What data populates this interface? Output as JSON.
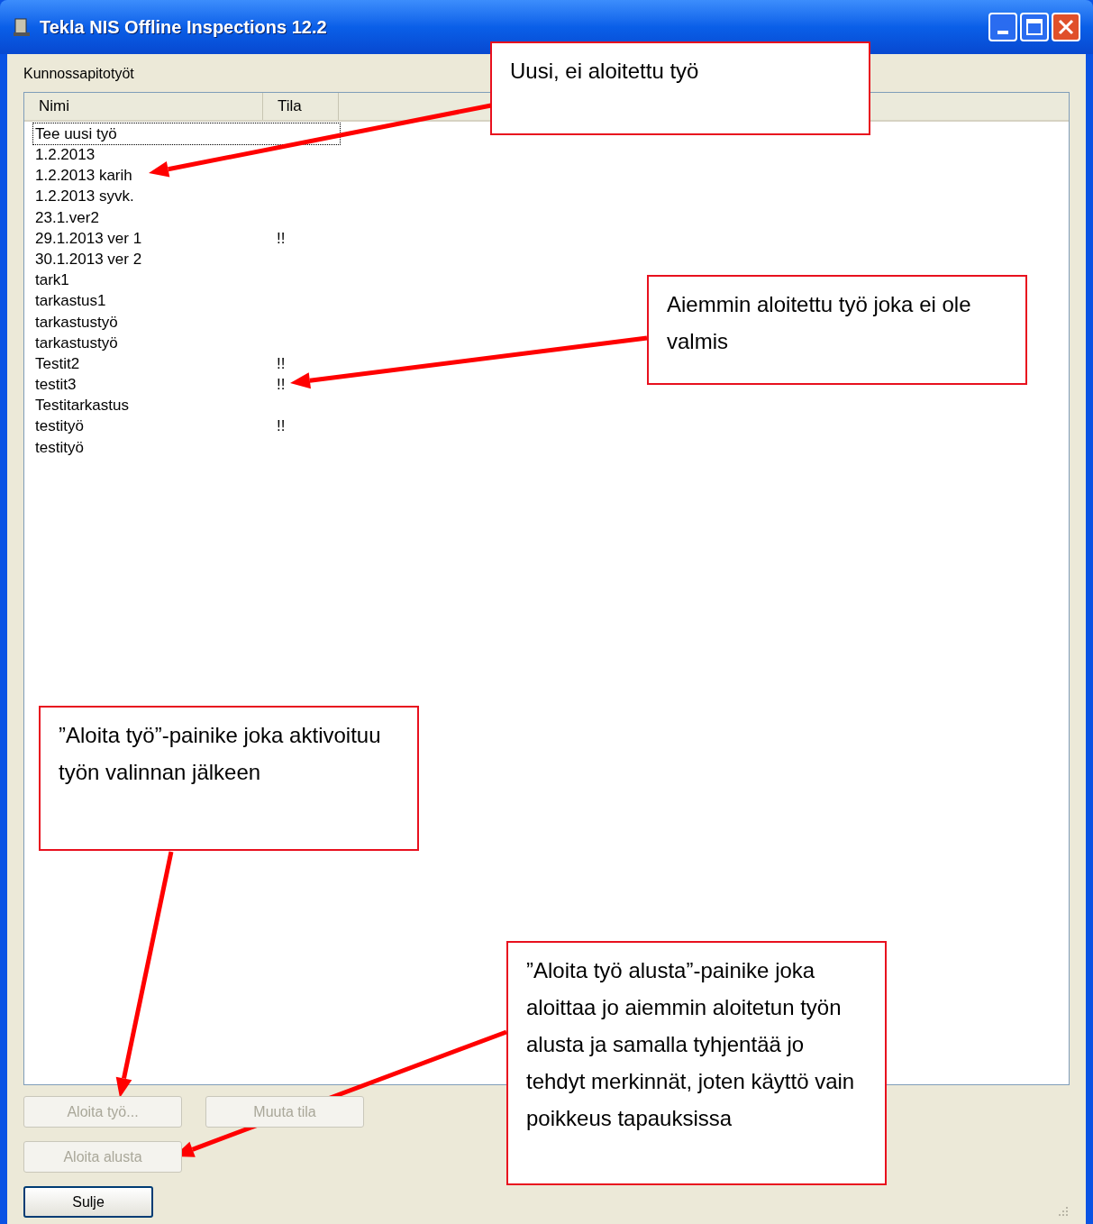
{
  "window": {
    "title": "Tekla NIS Offline Inspections 12.2"
  },
  "group_label": "Kunnossapitotyöt",
  "table": {
    "columns": [
      "Nimi",
      "Tila"
    ],
    "rows": [
      {
        "name": "Tee uusi työ",
        "status": "",
        "focused": true
      },
      {
        "name": "1.2.2013",
        "status": "",
        "focused": false
      },
      {
        "name": "1.2.2013 karih",
        "status": "",
        "focused": false
      },
      {
        "name": "1.2.2013 syvk.",
        "status": "",
        "focused": false
      },
      {
        "name": "23.1.ver2",
        "status": "",
        "focused": false
      },
      {
        "name": "29.1.2013 ver 1",
        "status": "!!",
        "focused": false
      },
      {
        "name": "30.1.2013 ver 2",
        "status": "",
        "focused": false
      },
      {
        "name": "tark1",
        "status": "",
        "focused": false
      },
      {
        "name": "tarkastus1",
        "status": "",
        "focused": false
      },
      {
        "name": "tarkastustyö",
        "status": "",
        "focused": false
      },
      {
        "name": "tarkastustyö",
        "status": "",
        "focused": false
      },
      {
        "name": "Testit2",
        "status": "!!",
        "focused": false
      },
      {
        "name": "testit3",
        "status": "!!",
        "focused": false
      },
      {
        "name": "Testitarkastus",
        "status": "",
        "focused": false
      },
      {
        "name": "testityö",
        "status": "!!",
        "focused": false
      },
      {
        "name": "testityö",
        "status": "",
        "focused": false
      }
    ]
  },
  "buttons": [
    {
      "label": "Aloita työ...",
      "disabled": true,
      "default": false
    },
    {
      "label": "Muuta tila",
      "disabled": true,
      "default": false
    },
    {
      "label": "Aloita alusta",
      "disabled": true,
      "default": false
    },
    {
      "label": "Sulje",
      "disabled": false,
      "default": true
    }
  ],
  "callouts": [
    {
      "text": "Uusi, ei aloitettu työ"
    },
    {
      "text": "Aiemmin aloitettu työ joka ei ole valmis"
    },
    {
      "text": "”Aloita työ”-painike joka aktivoituu työn valinnan jälkeen"
    },
    {
      "text": "”Aloita työ alusta”-painike joka aloittaa jo aiemmin aloitetun työn alusta ja samalla tyhjentää jo tehdyt merkinnät, joten käyttö vain poikkeus tapauksissa"
    }
  ]
}
